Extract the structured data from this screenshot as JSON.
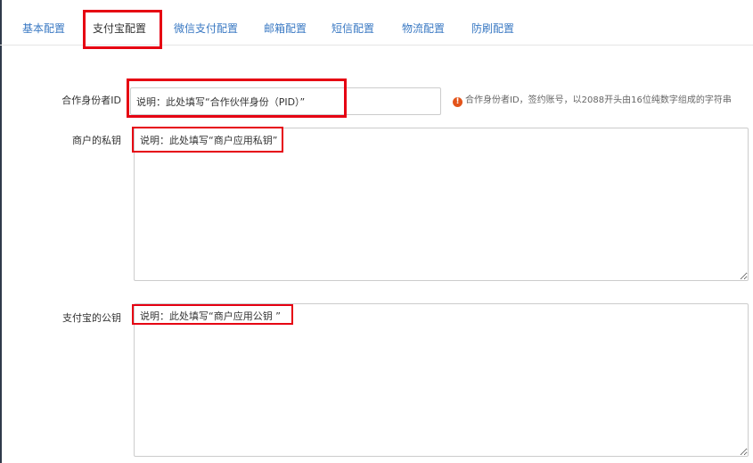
{
  "tabs": [
    {
      "label": "基本配置",
      "active": false
    },
    {
      "label": "支付宝配置",
      "active": true
    },
    {
      "label": "微信支付配置",
      "active": false
    },
    {
      "label": "邮箱配置",
      "active": false
    },
    {
      "label": "短信配置",
      "active": false
    },
    {
      "label": "物流配置",
      "active": false
    },
    {
      "label": "防刷配置",
      "active": false
    }
  ],
  "form": {
    "partner_id": {
      "label": "合作身份者ID",
      "value": "说明：此处填写“合作伙伴身份（PID）”",
      "hint_icon": "exclamation-icon",
      "hint": "合作身份者ID，签约账号，以2088开头由16位纯数字组成的字符串"
    },
    "merchant_private_key": {
      "label": "商户的私钥",
      "value": "说明：此处填写“商户应用私钥”"
    },
    "alipay_public_key": {
      "label": "支付宝的公钥",
      "value": "说明：此处填写“商户应用公钥 ”"
    }
  },
  "colors": {
    "tab_link": "#3a79c3",
    "highlight": "#e60012",
    "hint_icon": "#e3541a",
    "border": "#cccccc"
  }
}
